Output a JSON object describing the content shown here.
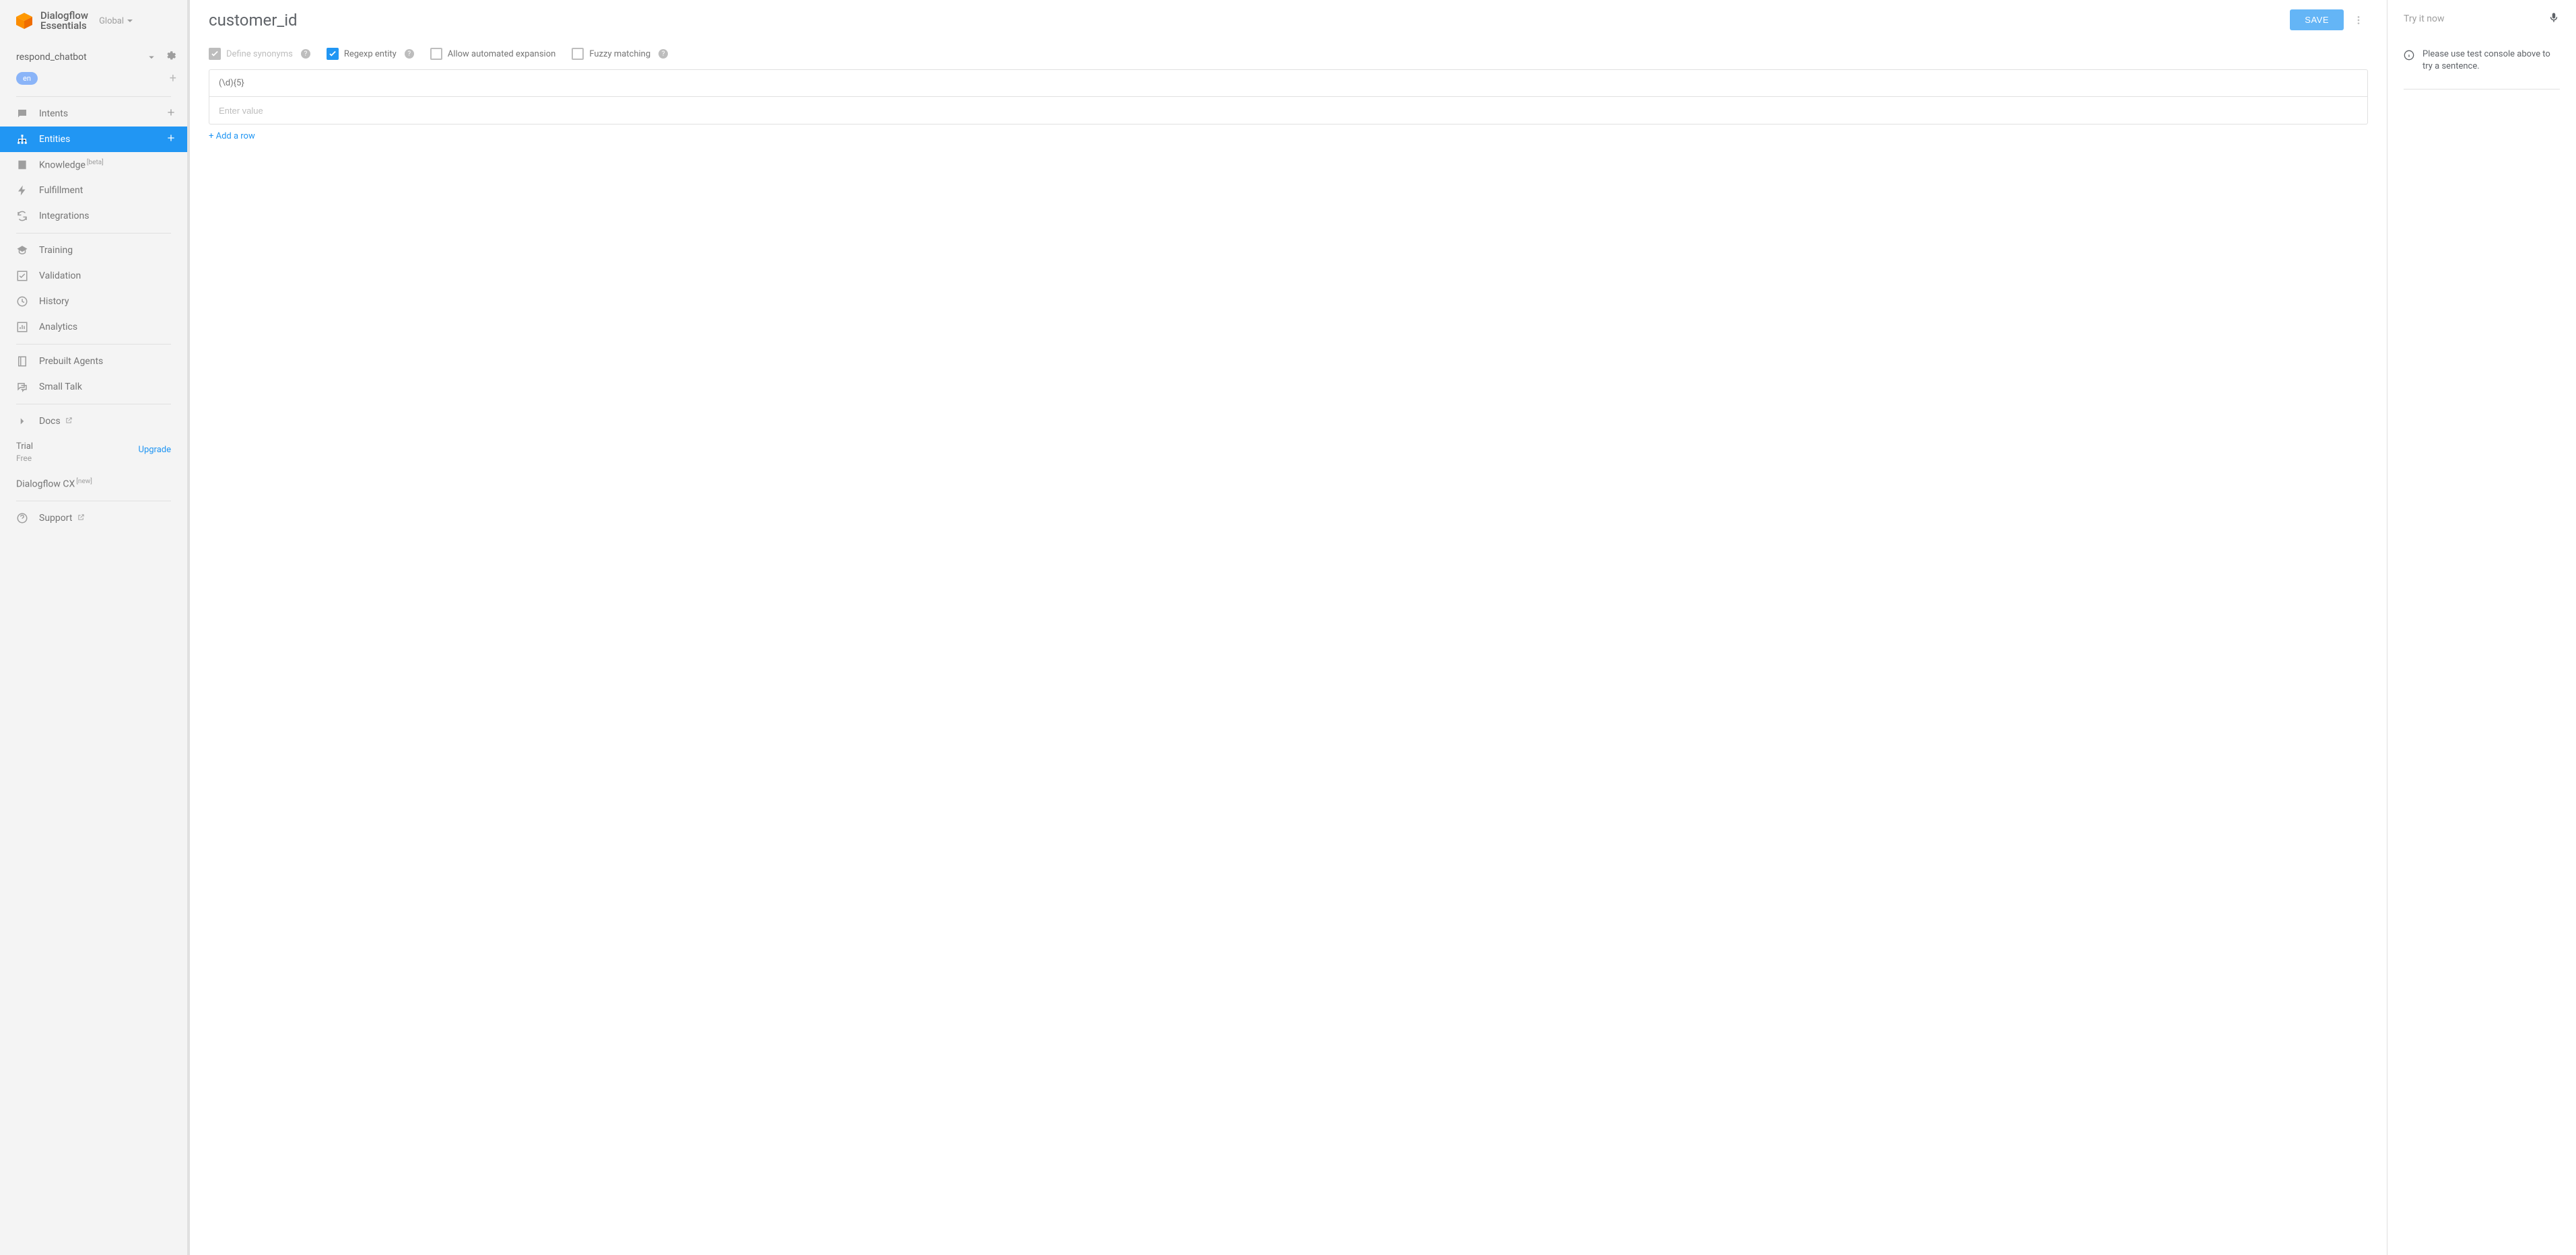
{
  "brand": {
    "line1": "Dialogflow",
    "line2": "Essentials",
    "region": "Global"
  },
  "agent": {
    "name": "respond_chatbot",
    "lang": "en"
  },
  "sidebar": {
    "items": [
      {
        "id": "intents",
        "label": "Intents",
        "add": true
      },
      {
        "id": "entities",
        "label": "Entities",
        "add": true,
        "active": true
      },
      {
        "id": "knowledge",
        "label": "Knowledge",
        "badge": "[beta]"
      },
      {
        "id": "fulfillment",
        "label": "Fulfillment"
      },
      {
        "id": "integrations",
        "label": "Integrations"
      },
      {
        "id": "training",
        "label": "Training"
      },
      {
        "id": "validation",
        "label": "Validation"
      },
      {
        "id": "history",
        "label": "History"
      },
      {
        "id": "analytics",
        "label": "Analytics"
      },
      {
        "id": "prebuilt",
        "label": "Prebuilt Agents"
      },
      {
        "id": "smalltalk",
        "label": "Small Talk"
      },
      {
        "id": "docs",
        "label": "Docs",
        "ext": true
      }
    ],
    "plan": {
      "title": "Trial",
      "sub": "Free",
      "upgrade": "Upgrade"
    },
    "cx": {
      "label": "Dialogflow CX",
      "badge": "[new]"
    },
    "support": "Support"
  },
  "main": {
    "title": "customer_id",
    "save": "SAVE",
    "opts": {
      "def_syn": {
        "label": "Define synonyms",
        "checked": true,
        "disabled": true,
        "help": true
      },
      "regexp": {
        "label": "Regexp entity",
        "checked": true,
        "disabled": false,
        "help": true
      },
      "auto_exp": {
        "label": "Allow automated expansion",
        "checked": false,
        "disabled": false,
        "help": false
      },
      "fuzzy": {
        "label": "Fuzzy matching",
        "checked": false,
        "disabled": false,
        "help": true
      }
    },
    "rows": [
      {
        "value": "(\\d){5}"
      }
    ],
    "input_placeholder": "Enter value",
    "add_row": "+ Add a row"
  },
  "right": {
    "try_placeholder": "Try it now",
    "info": "Please use test console above to try a sentence."
  }
}
